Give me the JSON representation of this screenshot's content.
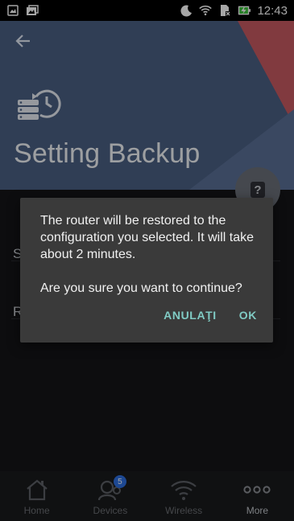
{
  "status_bar": {
    "time": "12:43"
  },
  "header": {
    "back_icon": "arrow-left-icon",
    "icon": "backup-history-icon",
    "title": "Setting Backup",
    "help_icon": "help-icon",
    "background_color": "#4b6083",
    "accent_color": "#c75a61"
  },
  "list": {
    "items": [
      {
        "label": "S"
      },
      {
        "label": "R"
      }
    ]
  },
  "dialog": {
    "message_1": "The router will be restored to the configuration you selected. It will take about 2 minutes.",
    "message_2": "Are you sure you want to continue?",
    "cancel_label": "ANULAŢI",
    "ok_label": "OK",
    "button_color": "#80cbc4"
  },
  "bottom_nav": {
    "items": [
      {
        "label": "Home",
        "icon": "home-icon"
      },
      {
        "label": "Devices",
        "icon": "devices-icon",
        "badge": "5"
      },
      {
        "label": "Wireless",
        "icon": "wifi-icon"
      },
      {
        "label": "More",
        "icon": "more-icon"
      }
    ]
  }
}
